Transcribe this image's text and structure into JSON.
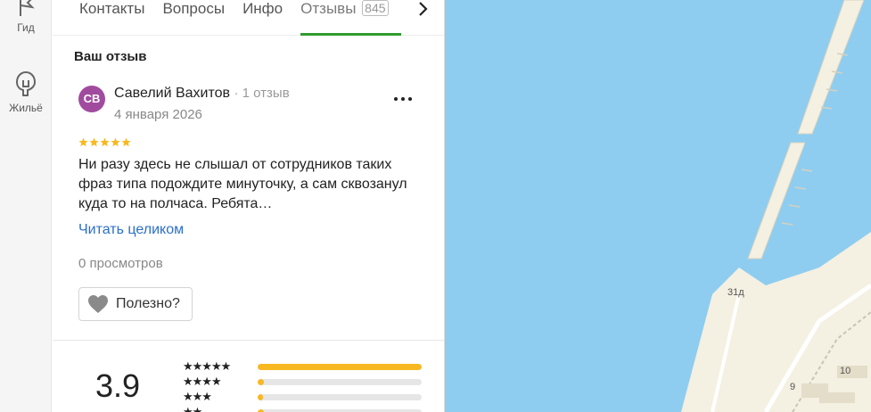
{
  "rail": {
    "items": [
      {
        "label": "Гид",
        "icon": "flag-icon"
      },
      {
        "label": "Жильё",
        "icon": "house-icon"
      }
    ]
  },
  "tabs": {
    "items": [
      {
        "label": "Контакты"
      },
      {
        "label": "Вопросы"
      },
      {
        "label": "Инфо"
      },
      {
        "label": "Отзывы",
        "count": "845",
        "active": true
      }
    ]
  },
  "your_review": {
    "title": "Ваш отзыв",
    "avatar_initials": "СВ",
    "avatar_color": "#a14b9f",
    "author_name": "Савелий Вахитов",
    "author_meta": "· 1 отзыв",
    "date": "4 января 2026",
    "stars": 5,
    "text": "Ни разу здесь не слышал от сотрудников таких фраз типа подождите минуточку, а сам сквозанул куда то на полчаса. Ребята…",
    "read_more": "Читать целиком",
    "views": "0 просмотров",
    "useful_label": "Полезно?"
  },
  "summary": {
    "rating": "3.9",
    "distribution": [
      {
        "stars": 5,
        "fraction": 1.0
      },
      {
        "stars": 4,
        "fraction": 0.04
      },
      {
        "stars": 3,
        "fraction": 0.03
      },
      {
        "stars": 2,
        "fraction": 0.04
      }
    ]
  },
  "map": {
    "labels": [
      "31д",
      "10",
      "9"
    ]
  },
  "colors": {
    "accent_green": "#2e9c2e",
    "star_yellow": "#f8b821",
    "link_blue": "#2b6fc9",
    "water": "#8ecdf0",
    "land": "#f4f0e2"
  }
}
